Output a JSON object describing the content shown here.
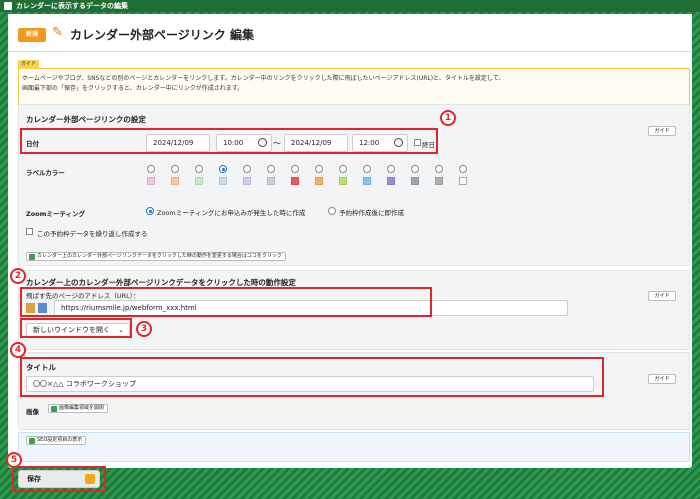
{
  "window": {
    "title": "カレンダーに表示するデータの編集"
  },
  "header": {
    "badge": "新規",
    "title": "カレンダー外部ページリンク 編集"
  },
  "guide": {
    "tag": "ガイド",
    "line1": "ホームページやブログ、SNSなどの別のページとカレンダーをリンクします。カレンダー中のリンクをクリックした際に飛ばしたいページアドレス(URL)と、タイトルを設定して、",
    "line2": "画面最下部の「保存」をクリックすると、カレンダー中にリンクが作成されます。"
  },
  "settings": {
    "title": "カレンダー外部ページリンクの設定",
    "guide_btn": "ガイド",
    "date_label": "日付",
    "start_date": "2024/12/09",
    "start_time": "10:00",
    "tilde": "〜",
    "end_date": "2024/12/09",
    "end_time": "12:00",
    "allday_label": "終日",
    "color_label": "ラベルカラー",
    "colors": [
      "#f5c5e0",
      "#f7c9a0",
      "#c8ecc4",
      "#c9daf5",
      "#d9c9f0",
      "#c8cfd6",
      "#e85a5a",
      "#f5b25a",
      "#b6e26a",
      "#7ec8f5",
      "#a08ad6",
      "#9aa7b3",
      "#b0b0b0",
      "#ffffff"
    ],
    "zoom_label": "Zoomミーティング",
    "zoom_opt1": "Zoomミーティングにお申込みが発生した時に作成",
    "zoom_opt2": "予約枠作成後に即作成",
    "repeat_label": "この予約枠データを繰り返し作成する",
    "change_btn": "カレンダー上のカレンダー外部ページリンクデータをクリックした時の動作を変更する場合はココをクリック"
  },
  "action": {
    "title": "カレンダー上のカレンダー外部ページリンクデータをクリックした時の動作設定",
    "guide_btn": "ガイド",
    "url_label": "飛ばす先のページのアドレス（URL）：",
    "url_value": "https://riumsmile.jp/webform_xxx.html",
    "window_select": "新しいウインドウを開く"
  },
  "title_section": {
    "label": "タイトル",
    "guide_btn": "ガイド",
    "value": "〇〇×△△ コラボワークショップ",
    "image_label": "画像",
    "image_btn": "画像編集領域を開閉"
  },
  "seo": {
    "btn": "SEO設定項目の表示"
  },
  "footer": {
    "save": "保存"
  },
  "markers": [
    "1",
    "2",
    "3",
    "4",
    "5"
  ],
  "accent": "#e0252b"
}
